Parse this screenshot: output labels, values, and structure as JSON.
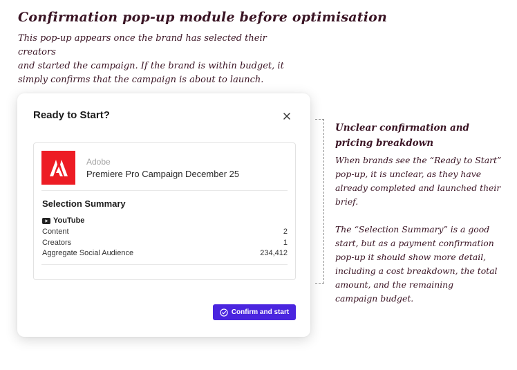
{
  "heading": "Confirmation pop-up module before optimisation",
  "intro_lines": [
    "This pop-up appears once the brand has selected their creators",
    "and started the campaign. If the brand is within budget, it",
    "simply confirms that the campaign is about to launch."
  ],
  "modal": {
    "title": "Ready to Start?",
    "close_icon": "close-icon",
    "brand_logo_icon": "adobe-logo-icon",
    "brand_color": "#ed1c24",
    "brand": "Adobe",
    "campaign": "Premiere Pro Campaign December 25",
    "summary_title": "Selection Summary",
    "platform_icon": "youtube-icon",
    "platform": "YouTube",
    "rows": [
      {
        "label": "Content",
        "value": "2"
      },
      {
        "label": "Creators",
        "value": "1"
      },
      {
        "label": "Aggregate Social Audience",
        "value": "234,412"
      }
    ],
    "confirm_icon": "check-circle-icon",
    "confirm_label": "Confirm and start",
    "accent_color": "#4a25df"
  },
  "annotation": {
    "title_lines": [
      "Unclear confirmation and",
      "pricing breakdown"
    ],
    "paragraph1_lines": [
      "When brands see the “Ready to Start”",
      "pop-up, it is unclear, as they have",
      "already completed and launched their",
      "brief."
    ],
    "paragraph2_lines": [
      "The “Selection Summary” is a good",
      "start, but as a payment confirmation",
      "pop-up it should show more detail,",
      "including a cost breakdown, the total",
      "amount, and the remaining",
      "campaign budget."
    ]
  }
}
